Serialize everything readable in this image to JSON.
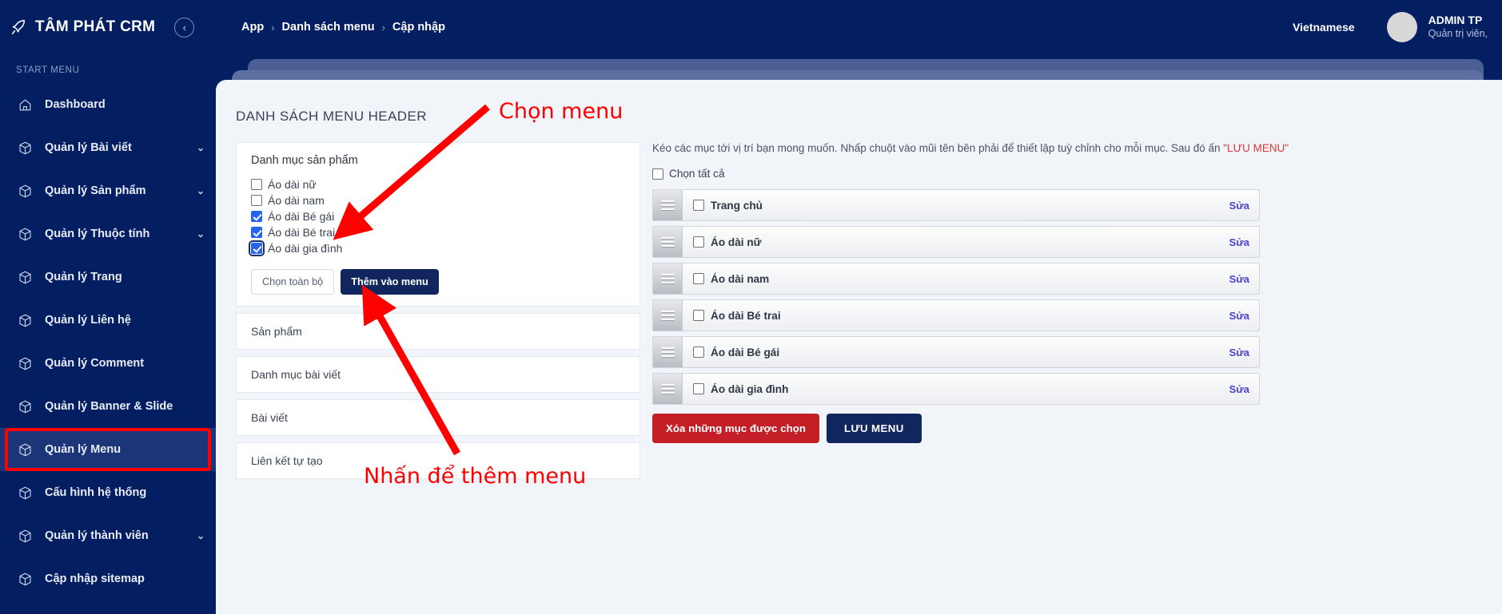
{
  "sidebar": {
    "brand": "TÂM PHÁT CRM",
    "collapse_icon": "chevron-left-circle-icon",
    "section_label": "START MENU",
    "items": [
      {
        "label": "Dashboard",
        "icon": "home-icon",
        "chevron": "",
        "active": false
      },
      {
        "label": "Quản lý Bài viết",
        "icon": "cube-icon",
        "chevron": "⌄",
        "active": false
      },
      {
        "label": "Quản lý Sản phẩm",
        "icon": "cube-icon",
        "chevron": "⌄",
        "active": false
      },
      {
        "label": "Quản lý Thuộc tính",
        "icon": "cube-icon",
        "chevron": "⌄",
        "active": false
      },
      {
        "label": "Quản lý Trang",
        "icon": "cube-icon",
        "chevron": "",
        "active": false
      },
      {
        "label": "Quản lý Liên hệ",
        "icon": "cube-icon",
        "chevron": "",
        "active": false
      },
      {
        "label": "Quản lý Comment",
        "icon": "cube-icon",
        "chevron": "",
        "active": false
      },
      {
        "label": "Quản lý Banner & Slide",
        "icon": "cube-icon",
        "chevron": "",
        "active": false
      },
      {
        "label": "Quản lý Menu",
        "icon": "cube-icon",
        "chevron": "",
        "active": true
      },
      {
        "label": "Cấu hình hệ thống",
        "icon": "cube-icon",
        "chevron": "",
        "active": false
      },
      {
        "label": "Quản lý thành viên",
        "icon": "cube-icon",
        "chevron": "⌄",
        "active": false
      },
      {
        "label": "Cập nhập sitemap",
        "icon": "cube-icon",
        "chevron": "",
        "active": false
      }
    ]
  },
  "topbar": {
    "breadcrumb": [
      "App",
      "Danh sách menu",
      "Cập nhập"
    ],
    "separator": "›",
    "language": "Vietnamese",
    "user_name": "ADMIN TP",
    "user_role": "Quản trị viên,"
  },
  "main": {
    "page_title": "DANH SÁCH MENU HEADER",
    "left": {
      "open_group": {
        "title": "Danh mục sản phẩm",
        "options": [
          {
            "label": "Áo dài nữ",
            "checked": false
          },
          {
            "label": "Áo dài nam",
            "checked": false
          },
          {
            "label": "Áo dài Bé gái",
            "checked": true
          },
          {
            "label": "Áo dài Bé trai",
            "checked": true
          },
          {
            "label": "Áo dài gia đình",
            "checked": true,
            "focused": true
          }
        ],
        "select_all_label": "Chọn toàn bộ",
        "add_label": "Thêm vào menu"
      },
      "closed_groups": [
        "Sản phẩm",
        "Danh mục bài viết",
        "Bài viết",
        "Liên kết tự tạo"
      ]
    },
    "right": {
      "hint_prefix": "Kéo các mục tới vị trí bạn mong muốn. Nhấp chuột vào mũi tên bên phải để thiết lập tuỳ chỉnh cho mỗi mục. Sau đó ấn ",
      "hint_highlight": "\"LƯU MENU\"",
      "select_all_label": "Chọn tất cả",
      "select_all_checked": false,
      "edit_label": "Sửa",
      "drag_handle_icon": "drag-handle-icon",
      "rows": [
        {
          "label": "Trang chủ",
          "checked": false
        },
        {
          "label": "Áo dài nữ",
          "checked": false
        },
        {
          "label": "Áo dài nam",
          "checked": false
        },
        {
          "label": "Áo dài Bé trai",
          "checked": false
        },
        {
          "label": "Áo dài Bé gái",
          "checked": false
        },
        {
          "label": "Áo dài gia đình",
          "checked": false
        }
      ],
      "delete_label": "Xóa những mục được chọn",
      "save_label": "LƯU MENU"
    }
  },
  "annotations": {
    "top": "Chọn menu",
    "bottom": "Nhấn để thêm menu",
    "color": "#ff0000"
  },
  "colors": {
    "navy": "#041e62",
    "active_nav": "#1c3578",
    "accent_red": "#ff0000",
    "button_red": "#c41e26",
    "button_navy": "#11265f",
    "checkbox_blue": "#2563eb",
    "link_purple": "#4b3fd0",
    "page_bg": "#f1f4f9"
  }
}
